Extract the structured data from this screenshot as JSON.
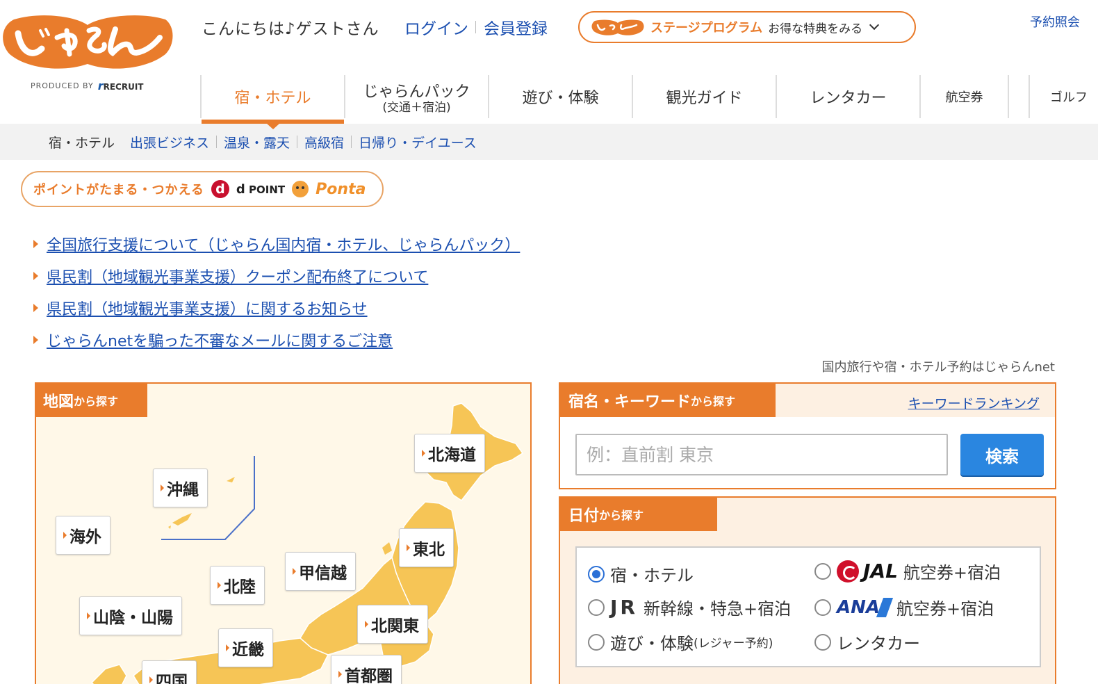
{
  "header": {
    "greeting": "こんにちは♪ゲストさん",
    "login_label": "ログイン",
    "register_label": "会員登録",
    "stage_program_title": "ステージプログラム",
    "stage_program_sub": "お得な特典をみる",
    "reservation_label": "予約照会",
    "produced_by": "PRODUCED BY",
    "recruit": "RECRUIT"
  },
  "main_nav": {
    "items": [
      {
        "label": "宿・ホテル",
        "sub": ""
      },
      {
        "label": "じゃらんパック",
        "sub": "(交通＋宿泊)"
      },
      {
        "label": "遊び・体験",
        "sub": ""
      },
      {
        "label": "観光ガイド",
        "sub": ""
      },
      {
        "label": "レンタカー",
        "sub": ""
      },
      {
        "label": "航空券",
        "sub": ""
      },
      {
        "label": "ゴルフ",
        "sub": ""
      }
    ]
  },
  "sub_nav": {
    "current": "宿・ホテル",
    "links": [
      "出張ビジネス",
      "温泉・露天",
      "高級宿",
      "日帰り・デイユース"
    ]
  },
  "points_banner": {
    "text": "ポイントがたまる・つかえる",
    "dpoint_mark": "d",
    "dpoint_label": "POINT",
    "ponta_label": "Ponta"
  },
  "notices": [
    "全国旅行支援について（じゃらん国内宿・ホテル、じゃらんパック）",
    "県民割（地域観光事業支援）クーポン配布終了について",
    "県民割（地域観光事業支援）に関するお知らせ",
    "じゃらんnetを騙った不審なメールに関するご注意"
  ],
  "tagline": "国内旅行や宿・ホテル予約はじゃらんnet",
  "map_search": {
    "title_main": "地図",
    "title_sub": "から探す",
    "regions": {
      "hokkaido": "北海道",
      "okinawa": "沖縄",
      "overseas": "海外",
      "tohoku": "東北",
      "koshinetsu": "甲信越",
      "hokuriku": "北陸",
      "sanin_sanyo": "山陰・山陽",
      "kitakanto": "北関東",
      "kinki": "近畿",
      "shikoku": "四国",
      "shutoken": "首都圏"
    }
  },
  "keyword_search": {
    "title_main": "宿名・キーワード",
    "title_sub": "から探す",
    "ranking_link": "キーワードランキング",
    "placeholder": "例：直前割 東京",
    "value": "",
    "search_label": "検索"
  },
  "date_search": {
    "title_main": "日付",
    "title_sub": "から探す",
    "options": {
      "hotel": "宿・ホテル",
      "jal_brand": "JAL",
      "jal_label": "航空券+宿泊",
      "jr_brand": "JR",
      "jr_label": "新幹線・特急+宿泊",
      "ana_brand": "ANA",
      "ana_label": "航空券+宿泊",
      "activity": "遊び・体験",
      "activity_note": "(レジャー予約)",
      "rentacar": "レンタカー"
    },
    "selected": "hotel"
  },
  "colors": {
    "brand_orange": "#e97c2c",
    "link_blue": "#1b4fb0",
    "search_blue": "#2a86e0",
    "map_land": "#f6c556"
  },
  "icons": [
    "jalan-logo",
    "recruit-logo",
    "chevron-down-icon",
    "dpoint-icon",
    "ponta-icon",
    "triangle-bullet-icon",
    "jal-logo-icon",
    "ana-logo-icon"
  ]
}
